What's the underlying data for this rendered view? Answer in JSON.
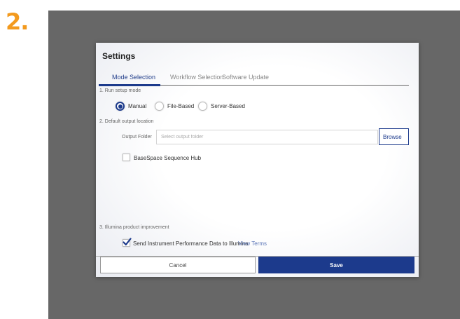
{
  "step": {
    "number": "2."
  },
  "colors": {
    "accent": "#1c3a8c",
    "step_number": "#f39a1e",
    "frame": "#676767"
  },
  "settings": {
    "title": "Settings",
    "tabs": [
      {
        "label": "Mode Selection",
        "active": true
      },
      {
        "label": "Workflow Selection",
        "active": false
      },
      {
        "label": "Software Update",
        "active": false
      }
    ],
    "run_setup_mode": {
      "label": "1. Run setup mode",
      "options": [
        {
          "label": "Manual",
          "selected": true
        },
        {
          "label": "File-Based",
          "selected": false
        },
        {
          "label": "Server-Based",
          "selected": false
        }
      ]
    },
    "default_output": {
      "label": "2. Default output location",
      "field_label": "Output Folder",
      "placeholder": "Select output folder",
      "value": "",
      "browse_label": "Browse",
      "basespace_label": "BaseSpace Sequence Hub",
      "basespace_checked": false
    },
    "product_improvement": {
      "label": "3. Illumina product improvement",
      "send_label": "Send Instrument Performance Data to Illumina",
      "send_checked": true,
      "terms_link": "View Terms"
    },
    "footer": {
      "cancel_label": "Cancel",
      "save_label": "Save"
    }
  }
}
